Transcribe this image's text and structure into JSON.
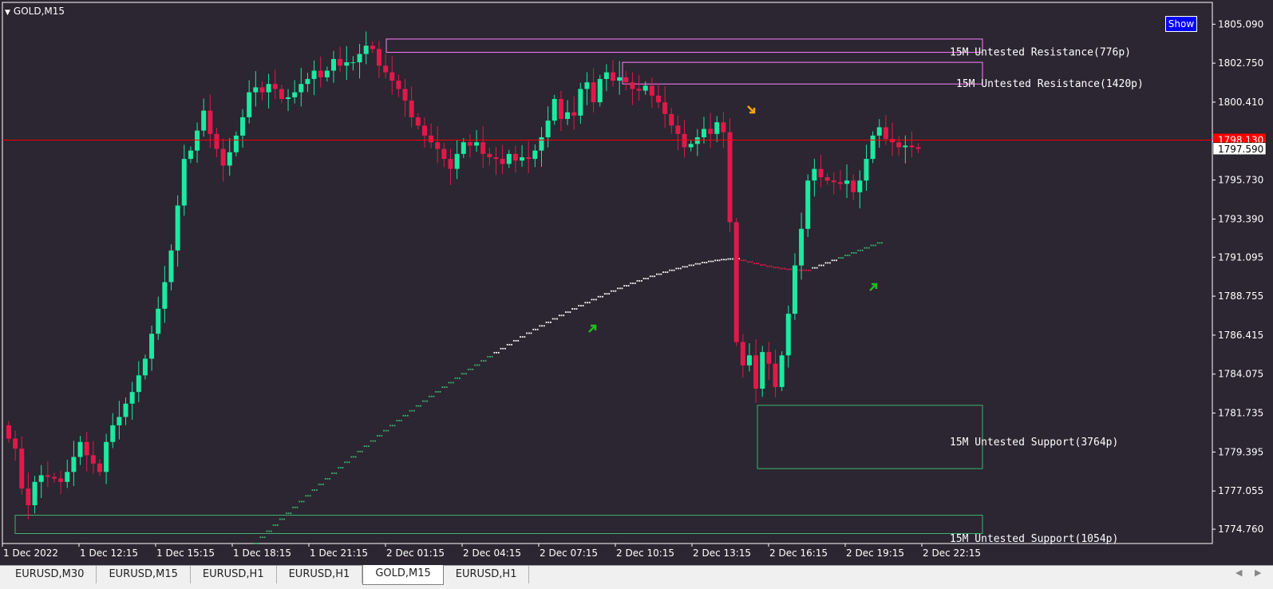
{
  "chart_title": "GOLD,M15",
  "show_button_label": "Show",
  "colors": {
    "background": "#2b2631",
    "bull": "#1de9a0",
    "bear": "#e0194b",
    "axis_text": "#ffffff",
    "bid_line": "#ff0000",
    "resistance_box": "#ff7fff",
    "support_box": "#3cb371",
    "ma_up": "#3cb371",
    "ma_flat": "#ffffff",
    "ma_down": "#e0194b",
    "arrow_up": "#22bb22",
    "arrow_down": "#ffa500"
  },
  "chart_data": {
    "type": "candlestick",
    "symbol": "GOLD",
    "timeframe": "M15",
    "ylim": [
      1773.9,
      1806.4
    ],
    "y_ticks": [
      "1805.090",
      "1802.750",
      "1800.410",
      "1798.070",
      "1795.730",
      "1793.390",
      "1791.095",
      "1788.755",
      "1786.415",
      "1784.075",
      "1781.735",
      "1779.395",
      "1777.055",
      "1774.760"
    ],
    "x_tick_labels": [
      "1 Dec 2022",
      "1 Dec 12:15",
      "1 Dec 15:15",
      "1 Dec 18:15",
      "1 Dec 21:15",
      "2 Dec 01:15",
      "2 Dec 04:15",
      "2 Dec 07:15",
      "2 Dec 10:15",
      "2 Dec 13:15",
      "2 Dec 16:15",
      "2 Dec 19:15",
      "2 Dec 22:15"
    ],
    "bid_price": "1798.130",
    "current_price": "1797.590",
    "closes": [
      1780.2,
      1779.6,
      1777.2,
      1776.2,
      1777.6,
      1778.0,
      1777.9,
      1777.8,
      1777.6,
      1778.2,
      1779.1,
      1780.0,
      1779.2,
      1778.7,
      1778.2,
      1780.0,
      1781.0,
      1781.5,
      1782.3,
      1783.0,
      1784.0,
      1785.0,
      1786.5,
      1788.0,
      1789.6,
      1791.5,
      1794.2,
      1797.0,
      1797.5,
      1798.7,
      1799.9,
      1798.5,
      1797.6,
      1796.6,
      1797.4,
      1798.4,
      1799.5,
      1801.0,
      1801.3,
      1801.0,
      1801.5,
      1801.2,
      1800.6,
      1800.7,
      1801.0,
      1801.5,
      1801.8,
      1802.3,
      1801.9,
      1802.3,
      1803.0,
      1802.6,
      1802.8,
      1802.8,
      1803.3,
      1803.8,
      1803.6,
      1802.6,
      1802.2,
      1801.7,
      1801.2,
      1800.5,
      1799.5,
      1799.0,
      1798.4,
      1798.0,
      1797.6,
      1797.0,
      1796.4,
      1797.3,
      1798.0,
      1797.8,
      1798.0,
      1797.3,
      1797.1,
      1797.0,
      1796.7,
      1797.3,
      1796.9,
      1797.1,
      1797.0,
      1797.5,
      1798.3,
      1799.3,
      1800.6,
      1799.4,
      1799.8,
      1799.6,
      1801.2,
      1801.6,
      1800.4,
      1801.8,
      1802.2,
      1801.7,
      1801.9,
      1801.6,
      1801.2,
      1801.1,
      1801.4,
      1800.8,
      1800.4,
      1799.7,
      1799.0,
      1798.5,
      1797.7,
      1797.9,
      1798.3,
      1798.8,
      1798.5,
      1799.2,
      1798.6,
      1793.2,
      1786.0,
      1784.6,
      1785.2,
      1783.2,
      1785.4,
      1784.7,
      1783.3,
      1785.2,
      1787.7,
      1790.6,
      1792.8,
      1795.7,
      1796.4,
      1795.9,
      1795.7,
      1795.6,
      1795.5,
      1795.7,
      1795.0,
      1795.7,
      1797.0,
      1798.4,
      1798.9,
      1798.2,
      1798.0,
      1797.7,
      1797.8,
      1797.7,
      1797.6
    ],
    "moving_average_endpoints": {
      "start": 1773.9,
      "mid": 1791.0,
      "dip": 1790.3,
      "end": 1792.1
    },
    "zones": [
      {
        "kind": "resistance",
        "label": "15M Untested Resistance(776p)",
        "top": 1804.2,
        "bottom": 1803.4
      },
      {
        "kind": "resistance",
        "label": "15M Untested Resistance(1420p)",
        "top": 1802.8,
        "bottom": 1801.5
      },
      {
        "kind": "support",
        "label": "15M Untested Support(3764p)",
        "top": 1782.2,
        "bottom": 1778.4
      },
      {
        "kind": "support",
        "label": "15M Untested Support(1054p)",
        "top": 1775.6,
        "bottom": 1774.5
      }
    ]
  },
  "tabs": [
    {
      "label": "EURUSD,M30",
      "active": false
    },
    {
      "label": "EURUSD,M15",
      "active": false
    },
    {
      "label": "EURUSD,H1",
      "active": false
    },
    {
      "label": "EURUSD,H1",
      "active": false
    },
    {
      "label": "GOLD,M15",
      "active": true
    },
    {
      "label": "EURUSD,H1",
      "active": false
    }
  ],
  "scroll_left_glyph": "◀",
  "scroll_right_glyph": "▶"
}
